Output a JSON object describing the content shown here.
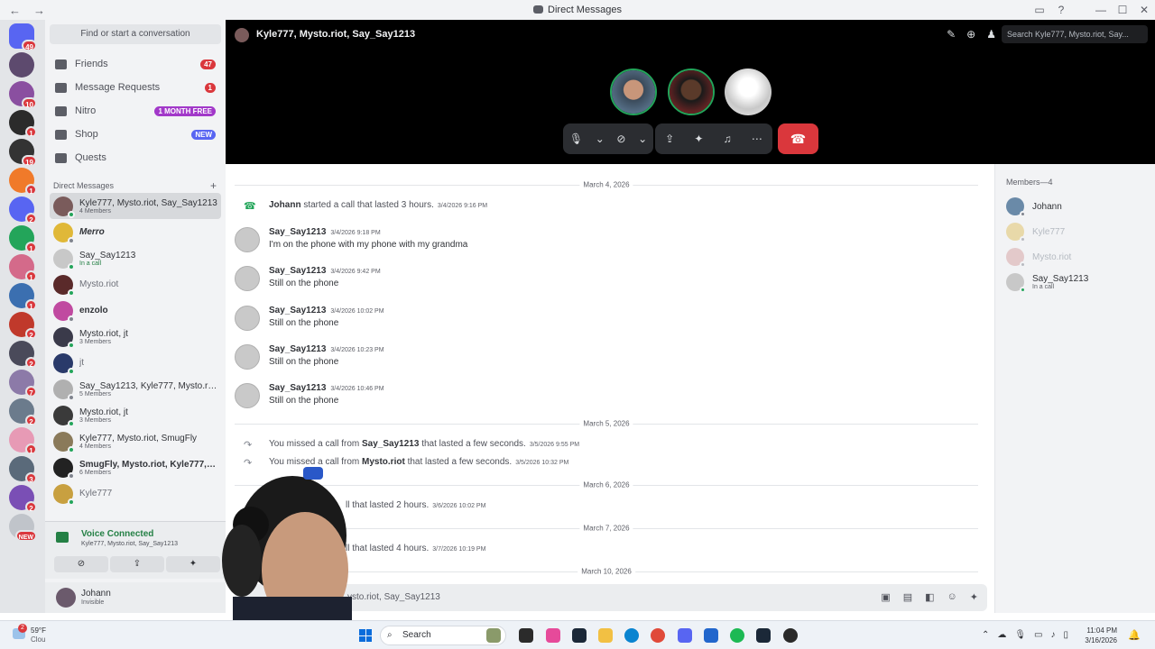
{
  "window": {
    "title": "Direct Messages"
  },
  "servers": [
    {
      "badge": "49",
      "color": "#5865f2"
    },
    {
      "badge": "",
      "color": "#5d4a6e"
    },
    {
      "badge": "10",
      "color": "#8a4fa0"
    },
    {
      "badge": "1",
      "color": "#2b2b2b"
    },
    {
      "badge": "19",
      "color": "#333333"
    },
    {
      "badge": "1",
      "color": "#f07a2a"
    },
    {
      "badge": "2",
      "color": "#5865f2"
    },
    {
      "badge": "1",
      "color": "#23a55a"
    },
    {
      "badge": "1",
      "color": "#d46a8a"
    },
    {
      "badge": "1",
      "color": "#3b6fb0"
    },
    {
      "badge": "2",
      "color": "#c0392b"
    },
    {
      "badge": "2",
      "color": "#4a4a5a"
    },
    {
      "badge": "7",
      "color": "#8c7aa8"
    },
    {
      "badge": "2",
      "color": "#6b7b8c"
    },
    {
      "badge": "1",
      "color": "#e79ab5"
    },
    {
      "badge": "3",
      "color": "#5a6a7a"
    },
    {
      "badge": "2",
      "color": "#7a4fb5"
    },
    {
      "badge": "NEW",
      "color": "#c0c4ca"
    }
  ],
  "sidebar": {
    "search_placeholder": "Find or start a conversation",
    "nav": [
      {
        "label": "Friends",
        "badge": "47",
        "icon": "friends-icon"
      },
      {
        "label": "Message Requests",
        "badge": "1",
        "icon": "message-requests-icon"
      },
      {
        "label": "Nitro",
        "badge": "1 MONTH FREE",
        "icon": "nitro-icon"
      },
      {
        "label": "Shop",
        "badge": "NEW",
        "icon": "shop-icon"
      },
      {
        "label": "Quests",
        "badge": "",
        "icon": "quests-icon"
      }
    ],
    "dm_header": "Direct Messages",
    "dm_add": "+",
    "dms": [
      {
        "name": "Kyle777, Mysto.riot, Say_Say1213",
        "sub": "4 Members",
        "color": "#7a5b5b"
      },
      {
        "name": "Merro",
        "sub": "",
        "color": "#e0b838"
      },
      {
        "name": "Say_Say1213",
        "sub": "In a call",
        "color": "#c8c8c8"
      },
      {
        "name": "Mysto.riot",
        "sub": "",
        "color": "#5a2a2a"
      },
      {
        "name": "enzolo",
        "sub": "",
        "color": "#c04aa0"
      },
      {
        "name": "Mysto.riot, jt",
        "sub": "3 Members",
        "color": "#3a3a4a"
      },
      {
        "name": "jt",
        "sub": "",
        "color": "#2a3a6a"
      },
      {
        "name": "Say_Say1213, Kyle777, Mysto.rio...",
        "sub": "5 Members",
        "color": "#b0b0b0"
      },
      {
        "name": "Mysto.riot, jt",
        "sub": "3 Members",
        "color": "#3a3a3a"
      },
      {
        "name": "Kyle777, Mysto.riot, SmugFly",
        "sub": "4 Members",
        "color": "#8a7a5a"
      },
      {
        "name": "SmugFly, Mysto.riot, Kyle777, B...",
        "sub": "6 Members",
        "color": "#222222"
      },
      {
        "name": "Kyle777",
        "sub": "",
        "color": "#c8a040"
      }
    ]
  },
  "voice": {
    "status": "Voice Connected",
    "channel": "Kyle777, Mysto.riot, Say_Say1213"
  },
  "user": {
    "name": "Johann",
    "status": "Invisible"
  },
  "call": {
    "channel_name": "Kyle777, Mysto.riot, Say_Say1213",
    "search_placeholder": "Search Kyle777, Mysto.riot, Say...",
    "participants": [
      {
        "name": "Johann",
        "color": "#6a8aa8",
        "ring": "#23a55a"
      },
      {
        "name": "Kyle777",
        "color": "#7a3030",
        "ring": "#23a55a"
      },
      {
        "name": "Say_Say1213",
        "color": "#e8e8e8",
        "ring": "none"
      }
    ]
  },
  "chat": {
    "items": [
      {
        "kind": "sep",
        "date": "March 4, 2026"
      },
      {
        "kind": "sys",
        "icon": "phone-icon",
        "icon_color": "#23a55a",
        "actor": "Johann",
        "text": "started a call that lasted 3 hours.",
        "time": "3/4/2026 9:16 PM"
      },
      {
        "kind": "msg",
        "author": "Say_Say1213",
        "time": "3/4/2026 9:18 PM",
        "text": "I'm on the phone with my phone with my grandma"
      },
      {
        "kind": "msg",
        "author": "Say_Say1213",
        "time": "3/4/2026 9:42 PM",
        "text": "Still on the phone"
      },
      {
        "kind": "msg",
        "author": "Say_Say1213",
        "time": "3/4/2026 10:02 PM",
        "text": "Still on the phone"
      },
      {
        "kind": "msg",
        "author": "Say_Say1213",
        "time": "3/4/2026 10:23 PM",
        "text": "Still on the phone"
      },
      {
        "kind": "msg",
        "author": "Say_Say1213",
        "time": "3/4/2026 10:46 PM",
        "text": "Still on the phone"
      },
      {
        "kind": "sep",
        "date": "March 5, 2026"
      },
      {
        "kind": "missed",
        "prefix": "You missed a call from",
        "actor": "Say_Say1213",
        "suffix": "that lasted a few seconds.",
        "time": "3/5/2026 9:55 PM"
      },
      {
        "kind": "missed",
        "prefix": "You missed a call from",
        "actor": "Mysto.riot",
        "suffix": "that lasted a few seconds.",
        "time": "3/5/2026 10:32 PM"
      },
      {
        "kind": "sep",
        "date": "March 6, 2026"
      },
      {
        "kind": "partial",
        "text": "ll that lasted 2 hours.",
        "time": "3/6/2026 10:02 PM"
      },
      {
        "kind": "sep",
        "date": "March 7, 2026"
      },
      {
        "kind": "partial",
        "text": "ll that lasted 4 hours.",
        "time": "3/7/2026 10:19 PM"
      },
      {
        "kind": "sep",
        "date": "March 10, 2026"
      }
    ]
  },
  "composer": {
    "placeholder": "ysto.riot, Say_Say1213"
  },
  "members": {
    "header": "Members—4",
    "list": [
      {
        "name": "Johann",
        "sub": "",
        "faded": false,
        "color": "#6a8aa8"
      },
      {
        "name": "Kyle777",
        "sub": "",
        "faded": true,
        "color": "#e0c060"
      },
      {
        "name": "Mysto.riot",
        "sub": "",
        "faded": true,
        "color": "#d6a0a0"
      },
      {
        "name": "Say_Say1213",
        "sub": "In a call",
        "faded": false,
        "color": "#c8c8c8"
      }
    ]
  },
  "taskbar": {
    "weather_badge": "2",
    "temp": "59°F",
    "weather_text": "Clou",
    "search": "Search",
    "time": "11:04 PM",
    "date": "3/16/2026"
  }
}
